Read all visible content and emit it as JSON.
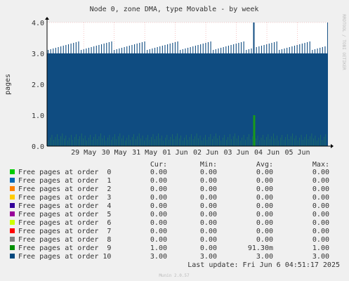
{
  "chart_data": {
    "type": "area",
    "title": "Node 0, zone DMA, type Movable - by week",
    "ylabel": "pages",
    "side_label": "RRDTOOL / TOBI OETIKER",
    "x_ticks": [
      "29 May",
      "30 May",
      "31 May",
      "01 Jun",
      "02 Jun",
      "03 Jun",
      "04 Jun",
      "05 Jun"
    ],
    "y_ticks": [
      "0.0",
      "1.0",
      "2.0",
      "3.0",
      "4.0"
    ],
    "ylim": [
      0,
      4
    ],
    "grid": true,
    "series": [
      {
        "name": "Free pages at order 10",
        "color": "#0f4c81",
        "values": [
          3,
          3,
          3,
          3,
          3,
          3,
          3,
          3,
          3,
          3,
          3,
          3,
          3,
          3,
          3,
          3,
          3,
          3,
          3,
          3,
          3,
          3,
          3,
          3,
          3,
          3,
          3,
          3,
          3,
          3,
          3,
          3,
          3,
          3,
          3,
          3,
          3,
          3,
          3,
          3,
          3,
          3,
          3,
          3,
          3,
          3,
          3,
          3,
          3,
          3,
          3,
          3,
          3,
          3,
          3,
          3,
          3,
          3,
          3,
          3,
          3,
          3,
          3,
          3,
          3,
          3,
          3,
          3,
          3,
          3,
          3,
          3,
          3,
          3,
          3,
          3,
          3,
          3,
          3,
          3,
          3,
          3,
          3,
          3,
          3,
          3,
          3,
          3,
          3,
          3,
          3,
          3,
          3,
          3,
          3,
          3,
          3,
          3,
          3,
          3,
          3,
          3,
          3,
          3,
          3,
          3,
          3,
          3,
          3,
          3,
          3,
          3,
          3,
          3,
          3,
          3,
          3,
          3,
          3,
          3,
          3,
          3,
          3,
          3,
          3,
          3,
          3,
          3,
          3,
          3,
          3,
          3,
          3,
          3,
          3,
          3,
          3,
          3,
          3,
          3,
          3,
          3,
          3,
          3,
          3,
          3,
          3,
          3,
          3,
          3,
          3,
          3,
          3,
          3,
          3,
          3,
          3,
          3,
          3,
          3,
          3,
          3,
          3,
          3,
          3,
          3,
          3,
          3,
          3,
          3,
          3,
          3,
          3,
          3,
          3,
          3,
          3,
          3,
          3,
          3,
          3,
          3,
          3,
          3,
          3,
          3,
          3,
          3,
          3,
          3,
          3,
          3,
          3,
          3,
          3,
          3,
          3,
          3,
          3,
          3,
          3,
          3,
          3,
          3,
          3,
          3,
          3,
          3,
          3,
          3,
          3,
          3,
          3,
          3,
          3,
          3,
          3,
          3,
          3,
          3,
          3,
          3,
          3,
          3,
          3,
          3,
          3,
          3,
          3,
          3,
          3,
          3,
          3,
          3,
          3,
          3,
          3,
          3,
          3,
          3,
          3,
          3,
          3,
          3,
          3,
          3,
          3,
          3,
          3,
          3,
          3,
          3,
          3,
          3,
          3,
          3,
          3,
          3,
          3,
          3,
          3,
          3,
          3,
          3,
          3,
          3,
          3,
          3,
          3,
          3,
          3,
          3,
          3,
          3,
          3,
          3,
          3,
          3,
          3,
          3,
          3,
          3,
          3,
          3,
          3,
          3,
          3,
          3,
          3,
          3,
          3,
          3,
          3,
          3,
          3,
          3,
          3,
          3,
          3,
          3,
          3,
          3,
          3,
          3,
          3,
          3,
          3,
          3,
          3,
          3,
          3,
          3,
          3,
          3,
          3,
          3,
          3,
          3,
          3,
          3,
          3,
          3,
          3,
          3,
          3,
          3,
          3,
          3,
          3,
          3,
          3,
          3,
          3,
          3,
          3,
          3,
          3,
          3,
          3,
          3,
          3,
          3,
          3,
          3,
          3,
          3,
          3,
          3,
          3,
          3,
          3,
          3,
          3,
          3,
          3,
          3,
          3,
          3,
          3,
          3,
          3,
          3,
          3,
          3,
          3,
          3,
          3,
          3,
          3,
          3,
          3,
          3,
          3,
          3,
          3,
          3,
          3,
          3,
          3,
          3,
          3,
          3,
          3,
          3,
          3,
          3,
          3,
          3,
          3,
          3,
          3,
          3,
          3,
          3,
          3,
          3,
          3,
          3,
          3,
          3,
          3,
          3,
          3,
          3,
          3,
          3,
          3,
          3,
          3,
          3,
          3,
          3,
          3,
          3,
          3,
          3,
          3,
          3,
          3,
          3,
          3,
          3,
          3,
          3,
          3,
          3,
          4
        ]
      },
      {
        "name": "Free pages at order 9",
        "color": "#1a9a1a",
        "values": [
          0,
          0,
          0,
          0,
          0,
          0,
          0,
          0,
          0,
          0,
          0,
          0,
          0,
          0,
          0,
          0,
          0,
          0,
          0,
          0,
          0,
          0,
          0,
          0,
          0,
          0,
          0,
          0,
          0,
          0,
          0,
          0,
          0,
          0,
          0,
          0,
          0,
          0,
          0,
          0,
          0,
          0,
          0,
          0,
          0,
          0,
          0,
          0,
          0,
          0,
          0,
          0,
          0,
          0,
          0,
          0,
          0,
          0,
          0,
          0,
          0,
          0,
          0,
          0,
          0,
          0,
          0,
          0,
          0,
          0,
          0,
          0,
          0,
          0,
          0,
          0,
          0,
          0,
          0,
          0,
          0,
          0,
          0,
          0,
          0,
          0,
          0,
          0,
          0,
          0,
          0,
          0,
          0,
          0,
          0,
          0,
          0,
          0,
          0,
          0,
          0,
          0,
          0,
          0,
          0,
          0,
          0,
          0,
          0,
          0,
          0,
          0,
          0,
          0,
          0,
          0,
          0,
          0,
          0,
          0,
          0,
          0,
          0,
          0,
          0,
          0,
          0,
          0,
          0,
          0,
          0,
          0,
          0,
          0,
          0,
          0,
          0,
          0,
          0,
          0,
          0,
          0,
          0,
          0,
          0,
          0,
          0,
          0,
          0,
          0,
          0,
          0,
          0,
          0,
          0,
          0,
          0,
          0,
          0,
          0,
          0,
          0,
          0,
          0,
          0,
          0,
          0,
          0,
          0,
          0,
          0,
          0,
          0,
          0,
          0,
          0,
          0,
          0,
          0,
          0,
          0,
          0,
          0,
          0,
          0,
          0,
          0,
          0,
          0,
          0,
          0,
          0,
          0,
          0,
          0,
          0,
          0,
          0,
          0,
          0,
          0,
          0,
          0,
          0,
          0,
          0,
          0,
          0,
          0,
          0,
          0,
          0,
          0,
          0,
          0,
          0,
          0,
          0,
          0,
          0,
          0,
          0,
          0,
          0,
          0,
          0,
          0,
          0,
          0,
          0,
          0,
          0,
          0,
          0,
          0,
          0,
          0,
          0,
          0,
          0,
          0,
          0,
          0,
          0,
          0,
          0,
          0,
          0,
          0,
          0,
          0,
          0,
          0,
          0,
          0,
          0,
          0,
          0,
          0,
          0,
          0,
          0,
          0,
          0,
          0,
          0,
          0,
          0,
          0,
          0,
          0,
          0,
          0,
          0,
          0,
          0,
          0,
          0,
          0,
          0,
          0,
          0,
          0,
          0,
          0,
          0,
          0,
          0,
          0,
          0,
          0,
          0,
          0,
          0,
          0,
          0,
          0,
          0,
          0,
          0,
          0,
          0,
          0,
          0,
          0,
          0,
          0,
          0,
          0,
          0,
          0,
          0,
          0,
          0,
          0,
          0,
          0,
          0,
          0,
          0,
          0,
          0,
          0,
          0,
          0,
          0,
          0,
          0,
          0,
          0,
          0,
          0,
          0,
          0,
          0,
          0,
          0,
          0,
          0,
          0,
          0,
          0,
          0,
          0,
          0,
          0,
          0,
          0,
          0,
          0,
          0,
          0,
          0,
          0,
          0,
          0,
          0,
          0,
          0,
          0,
          0,
          0,
          0,
          0,
          0,
          0,
          0,
          0,
          0,
          0,
          0,
          0,
          0,
          0,
          0,
          0,
          0,
          0,
          0,
          0,
          0,
          0,
          0,
          0,
          0,
          0,
          0,
          0,
          0,
          0,
          0,
          0,
          0,
          0,
          0,
          0,
          0,
          0,
          0,
          0,
          0,
          0,
          0,
          0,
          0,
          0,
          0,
          0,
          0,
          0,
          0,
          0,
          0,
          0,
          0,
          0,
          0,
          0,
          0,
          0,
          0,
          0,
          0,
          0,
          0,
          0,
          0,
          0,
          0,
          0,
          0,
          0,
          0,
          0,
          0,
          0,
          0,
          0,
          0,
          0,
          0,
          1
        ]
      }
    ]
  },
  "legend": {
    "headers": {
      "cur": "Cur:",
      "min": "Min:",
      "avg": "Avg:",
      "max": "Max:"
    },
    "rows": [
      {
        "label": "Free pages at order  0",
        "color": "#00cc00",
        "cur": "0.00",
        "min": "0.00",
        "avg": "0.00",
        "max": "0.00"
      },
      {
        "label": "Free pages at order  1",
        "color": "#0066b3",
        "cur": "0.00",
        "min": "0.00",
        "avg": "0.00",
        "max": "0.00"
      },
      {
        "label": "Free pages at order  2",
        "color": "#ff8000",
        "cur": "0.00",
        "min": "0.00",
        "avg": "0.00",
        "max": "0.00"
      },
      {
        "label": "Free pages at order  3",
        "color": "#ffcc00",
        "cur": "0.00",
        "min": "0.00",
        "avg": "0.00",
        "max": "0.00"
      },
      {
        "label": "Free pages at order  4",
        "color": "#330099",
        "cur": "0.00",
        "min": "0.00",
        "avg": "0.00",
        "max": "0.00"
      },
      {
        "label": "Free pages at order  5",
        "color": "#990099",
        "cur": "0.00",
        "min": "0.00",
        "avg": "0.00",
        "max": "0.00"
      },
      {
        "label": "Free pages at order  6",
        "color": "#ccff00",
        "cur": "0.00",
        "min": "0.00",
        "avg": "0.00",
        "max": "0.00"
      },
      {
        "label": "Free pages at order  7",
        "color": "#ff0000",
        "cur": "0.00",
        "min": "0.00",
        "avg": "0.00",
        "max": "0.00"
      },
      {
        "label": "Free pages at order  8",
        "color": "#808080",
        "cur": "0.00",
        "min": "0.00",
        "avg": "0.00",
        "max": "0.00"
      },
      {
        "label": "Free pages at order  9",
        "color": "#008f00",
        "cur": "1.00",
        "min": "0.00",
        "avg": "91.30m",
        "max": "1.00"
      },
      {
        "label": "Free pages at order 10",
        "color": "#00487d",
        "cur": "3.00",
        "min": "3.00",
        "avg": "3.00",
        "max": "3.00"
      }
    ]
  },
  "footer": {
    "last_update": "Last update: Fri Jun  6 04:51:17 2025",
    "version": "Munin 2.0.57"
  }
}
